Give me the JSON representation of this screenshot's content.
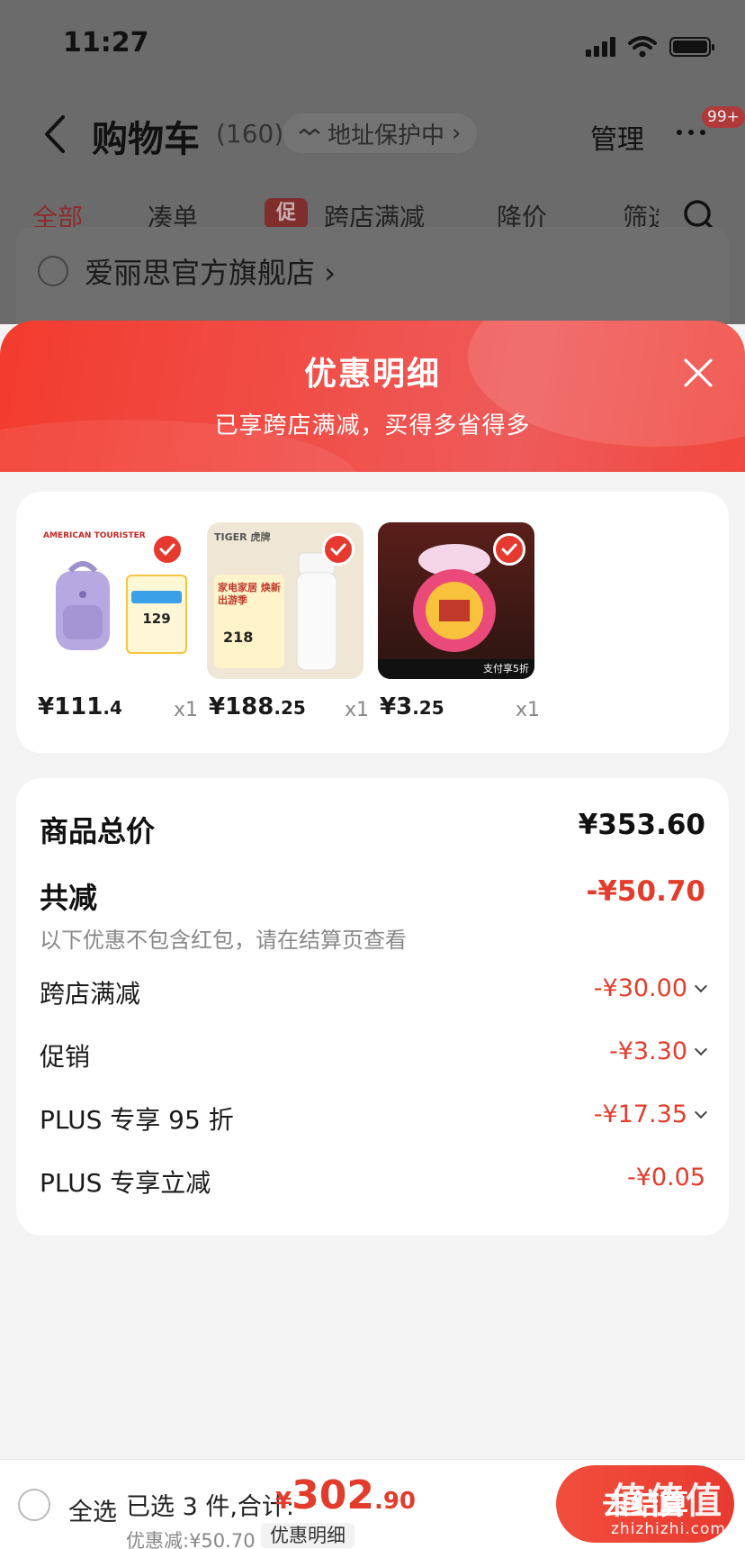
{
  "status_bar": {
    "time": "11:27"
  },
  "cart_header": {
    "title": "购物车",
    "count": "(160)",
    "address_protection": "地址保护中",
    "manage": "管理",
    "message_badge": "99+"
  },
  "filter_tabs": [
    {
      "label": "全部",
      "active": true
    },
    {
      "label": "凑单"
    },
    {
      "label": "跨店满减",
      "tag": "促"
    },
    {
      "label": "降价"
    },
    {
      "label": "筛选"
    }
  ],
  "store": {
    "name": "爱丽思官方旗舰店"
  },
  "modal": {
    "title": "优惠明细",
    "subtitle": "已享跨店满减，买得多省得多"
  },
  "products": [
    {
      "price_int": "¥111",
      "price_dec": ".4",
      "qty": "x1",
      "brand": "AMERICAN TOURISTER",
      "thumb_text": "129"
    },
    {
      "price_int": "¥188",
      "price_dec": ".25",
      "qty": "x1",
      "brand": "TIGER 虎牌",
      "thumb_text": "218",
      "thumb_label": "家电家居 焕新出游季"
    },
    {
      "price_int": "¥3",
      "price_dec": ".25",
      "qty": "x1",
      "thumb_text": "支付享5折"
    }
  ],
  "summary": {
    "goods_total_label": "商品总价",
    "goods_total_value": "¥353.60",
    "total_discount_label": "共减",
    "total_discount_value": "-¥50.70",
    "note": "以下优惠不包含红包，请在结算页查看",
    "items": [
      {
        "label": "跨店满减",
        "value": "-¥30.00",
        "expandable": true
      },
      {
        "label": "促销",
        "value": "-¥3.30",
        "expandable": true
      },
      {
        "label": "PLUS 专享 95 折",
        "value": "-¥17.35",
        "expandable": true
      },
      {
        "label": "PLUS 专享立减",
        "value": "-¥0.05",
        "expandable": false
      }
    ]
  },
  "bottom_bar": {
    "select_all": "全选",
    "selected_text": "已选 3 件,合计:",
    "total_currency": "¥",
    "total_int": "302",
    "total_dec": ".90",
    "discount_text": "优惠减:¥50.70",
    "detail_button": "优惠明细",
    "checkout": "去结算"
  },
  "watermark": {
    "text": "值值值",
    "sub": "zhizhizhi.com"
  },
  "colors": {
    "accent_red": "#e23d2c",
    "header_red": "#f23b2e"
  }
}
